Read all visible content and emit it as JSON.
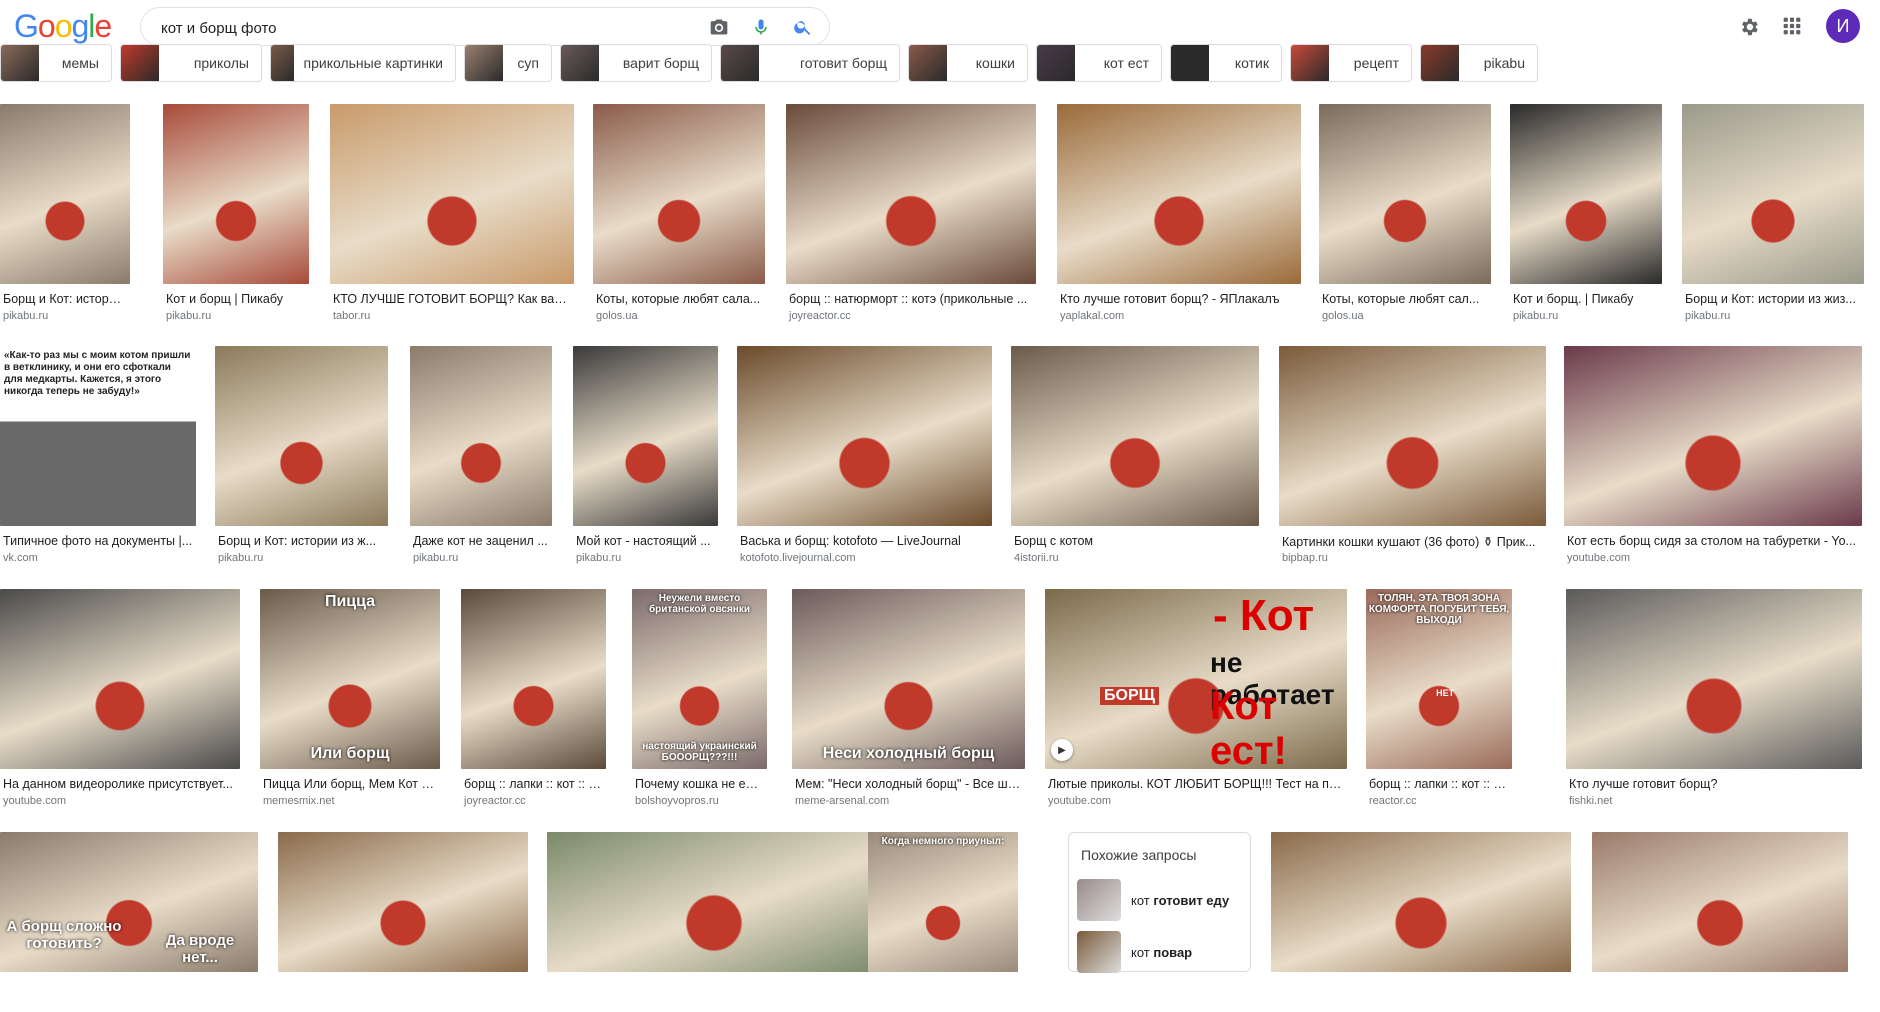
{
  "header": {
    "logo": [
      "G",
      "o",
      "o",
      "g",
      "l",
      "e"
    ],
    "logo_colors": [
      "#4285f4",
      "#ea4335",
      "#fbbc05",
      "#4285f4",
      "#34a853",
      "#ea4335"
    ],
    "search_value": "кот и борщ фото",
    "avatar_letter": "И"
  },
  "chips": [
    {
      "label": "мемы",
      "color": "#8a6a5a"
    },
    {
      "label": "приколы",
      "color": "#c0392b"
    },
    {
      "label": "прикольные картинки",
      "color": "#7a5a4a"
    },
    {
      "label": "суп",
      "color": "#9a8070"
    },
    {
      "label": "варит борщ",
      "color": "#6a5a5a"
    },
    {
      "label": "готовит борщ",
      "color": "#5a4a4a"
    },
    {
      "label": "кошки",
      "color": "#8a5a4a"
    },
    {
      "label": "кот ест",
      "color": "#4a3a4a"
    },
    {
      "label": "котик",
      "color": "#2a2a2a"
    },
    {
      "label": "рецепт",
      "color": "#c84a3a"
    },
    {
      "label": "pikabu",
      "color": "#8a3a2a"
    }
  ],
  "rows": [
    [
      {
        "caption": "Борщ и Кот: истории ...",
        "source": "pikabu.ru",
        "color": "#8a7a6a"
      },
      {
        "caption": "Кот и борщ | Пикабу",
        "source": "pikabu.ru",
        "color": "#a84a3a"
      },
      {
        "caption": "КТО ЛУЧШЕ ГОТОВИТ БОРЩ? Как вар...",
        "source": "tabor.ru",
        "color": "#c89a6a"
      },
      {
        "caption": "Коты, которые любят сала...",
        "source": "golos.ua",
        "color": "#8a5a4a"
      },
      {
        "caption": "борщ :: натюрморт :: котэ (прикольные ...",
        "source": "joyreactor.cc",
        "color": "#6a4a3a"
      },
      {
        "caption": "Кто лучше готовит борщ? - ЯПлакалъ",
        "source": "yaplakal.com",
        "color": "#9a6a3a"
      },
      {
        "caption": "Коты, которые любят сал...",
        "source": "golos.ua",
        "color": "#7a6a5a"
      },
      {
        "caption": "Кот и борщ. | Пикабу",
        "source": "pikabu.ru",
        "color": "#2a2a2a"
      },
      {
        "caption": "Борщ и Кот: истории из жиз...",
        "source": "pikabu.ru",
        "color": "#9a9a8a"
      }
    ],
    [
      {
        "caption": "Типичное фото на документы |...",
        "source": "vk.com",
        "color": "#6a6a6a",
        "text": "«Как-то раз мы с моим котом пришли в ветклинику, и они его сфоткали для медкарты. Кажется, я этого никогда теперь не забуду!»"
      },
      {
        "caption": "Борщ и Кот: истории из ж...",
        "source": "pikabu.ru",
        "color": "#8a7a5a"
      },
      {
        "caption": "Даже кот не заценил ...",
        "source": "pikabu.ru",
        "color": "#8a7a6a"
      },
      {
        "caption": "Мой кот - настоящий ...",
        "source": "pikabu.ru",
        "color": "#3a3a3a"
      },
      {
        "caption": "Васька и борщ: kotofoto — LiveJournal",
        "source": "kotofoto.livejournal.com",
        "color": "#6a4a2a"
      },
      {
        "caption": "Борщ с котом",
        "source": "4istorii.ru",
        "color": "#6a5a4a"
      },
      {
        "caption": "Картинки кошки кушают (36 фото) ⚱ Прик...",
        "source": "bipbap.ru",
        "color": "#7a5a3a"
      },
      {
        "caption": "Кот есть борщ сидя за столом на табуретки - Yo...",
        "source": "youtube.com",
        "color": "#6a3a4a"
      }
    ],
    [
      {
        "caption": "На данном видеоролике присутствует...",
        "source": "youtube.com",
        "color": "#4a4a4a"
      },
      {
        "caption": "Пицца Или борщ, Мем Кот з...",
        "source": "memesmix.net",
        "color": "#6a5a4a",
        "text_top": "Пицца",
        "text_bottom": "Или борщ"
      },
      {
        "caption": "борщ :: лапки :: кот :: п...",
        "source": "joyreactor.cc",
        "color": "#5a4a3a"
      },
      {
        "caption": "Почему кошка не ест ...",
        "source": "bolshoyvopros.ru",
        "color": "#7a6a6a",
        "text_top": "Неужели вместо британской овсянки",
        "text_bottom": "настоящий украинский БОООРЩ???!!!"
      },
      {
        "caption": "Мем: \"Неси холодный борщ\" - Все ша...",
        "source": "meme-arsenal.com",
        "color": "#6a5a5a",
        "text_bottom": "Неси холодный борщ"
      },
      {
        "caption": "Лютые приколы. КОТ ЛЮБИТ БОРЩ!!! Тест на пс...",
        "source": "youtube.com",
        "color": "#7a6a4a",
        "text_big1": "- Кот",
        "text_big2": "не работает",
        "text_big3": "Кот ест!",
        "text_pot": "БОРЩ"
      },
      {
        "caption": "борщ :: лапки :: кот :: прикол...",
        "source": "reactor.cc",
        "color": "#9a6a5a",
        "text_top": "ТОЛЯН, ЭТА ТВОЯ ЗОНА КОМФОРТА ПОГУБИТ ТЕБЯ, ВЫХОДИ",
        "text_small": "НЕТ"
      },
      {
        "caption": "Кто лучше готовит борщ?",
        "source": "fishki.net",
        "color": "#5a5a5a"
      }
    ],
    [
      {
        "color": "#8a7a6a",
        "text_left": "А борщ сложно готовить?",
        "text_right": "Да вроде нет..."
      },
      {
        "color": "#8a6a4a"
      },
      {
        "color": "#7a8a6a"
      },
      {
        "color": "#9a8a7a",
        "text_top": "Когда немного приуныл:"
      },
      {
        "color": "#8a6a4a"
      },
      {
        "color": "#9a7a6a"
      }
    ]
  ],
  "related": {
    "title": "Похожие запросы",
    "items": [
      {
        "pre": "кот ",
        "bold": "готовит еду",
        "color": "#9a8a8a"
      },
      {
        "pre": "кот ",
        "bold": "повар",
        "color": "#7a5a3a"
      }
    ]
  }
}
